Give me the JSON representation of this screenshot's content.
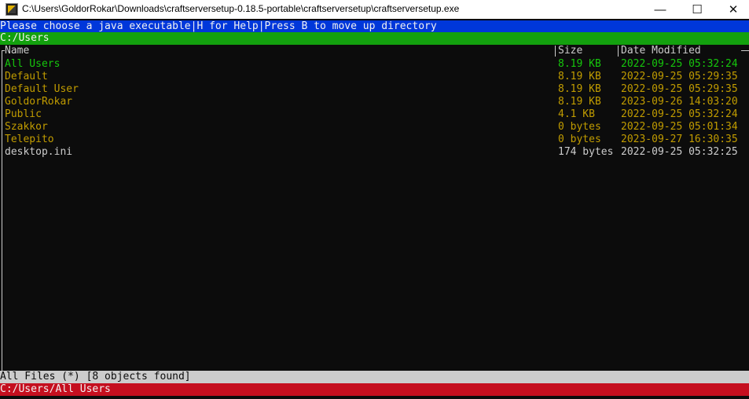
{
  "window": {
    "title": "C:\\Users\\GoldorRokar\\Downloads\\craftserversetup-0.18.5-portable\\craftserversetup\\craftserversetup.exe",
    "min_glyph": "—",
    "max_glyph": "☐",
    "close_glyph": "✕"
  },
  "prompt_bar": "Please choose a java executable|H for Help|Press B to move up directory",
  "current_path": "C:/Users",
  "columns": {
    "name": "Name",
    "size": "Size",
    "date": "Date Modified"
  },
  "entries": [
    {
      "name": "All Users",
      "size": "8.19 KB",
      "date": "2022-09-25 05:32:24",
      "color": "#16c60c"
    },
    {
      "name": "Default",
      "size": "8.19 KB",
      "date": "2022-09-25 05:29:35",
      "color": "#c19c00"
    },
    {
      "name": "Default User",
      "size": "8.19 KB",
      "date": "2022-09-25 05:29:35",
      "color": "#c19c00"
    },
    {
      "name": "GoldorRokar",
      "size": "8.19 KB",
      "date": "2023-09-26 14:03:20",
      "color": "#c19c00"
    },
    {
      "name": "Public",
      "size": "4.1 KB",
      "date": "2022-09-25 05:32:24",
      "color": "#c19c00"
    },
    {
      "name": "Szakkor",
      "size": "0 bytes",
      "date": "2022-09-25 05:01:34",
      "color": "#c19c00"
    },
    {
      "name": "Telepito",
      "size": "0 bytes",
      "date": "2023-09-27 16:30:35",
      "color": "#c19c00"
    },
    {
      "name": "desktop.ini",
      "size": "174 bytes",
      "date": "2022-09-25 05:32:25",
      "color": "#cccccc"
    }
  ],
  "filter_status": "All Files (*) [8 objects found]",
  "selected_path": "C:/Users/All Users",
  "colors": {
    "prompt_bg": "#0037da",
    "path_bg": "#13a10e",
    "status_bg": "#cccccc",
    "selection_bg": "#c50f1f"
  }
}
